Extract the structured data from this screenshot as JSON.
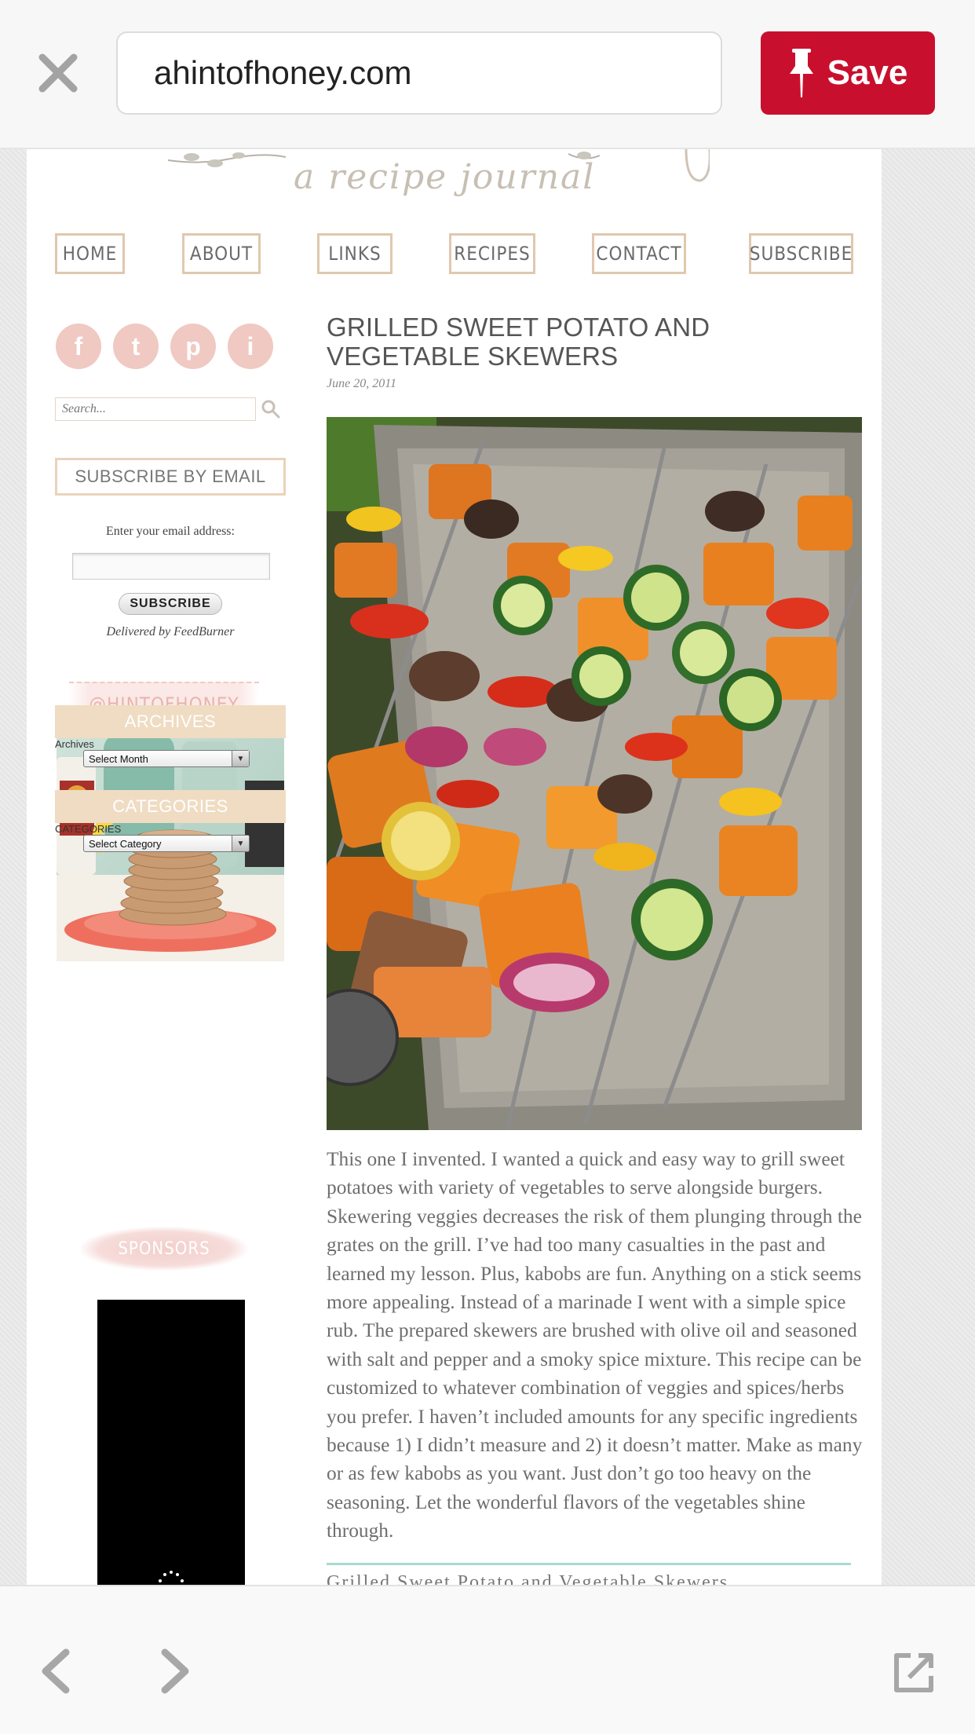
{
  "browser": {
    "url": "ahintofhoney.com",
    "save_label": "Save"
  },
  "site": {
    "tagline": "a recipe journal",
    "nav": [
      "HOME",
      "ABOUT",
      "LINKS",
      "RECIPES",
      "CONTACT",
      "SUBSCRIBE"
    ]
  },
  "sidebar": {
    "social": [
      "f",
      "t",
      "p",
      "i"
    ],
    "search_placeholder": "Search...",
    "subscribe_heading": "SUBSCRIBE BY EMAIL",
    "email_label": "Enter your email address:",
    "subscribe_button": "SUBSCRIBE",
    "delivered_prefix": "Delivered by ",
    "delivered_link": "FeedBurner",
    "handle": "@HINTOFHONEY",
    "archives_heading": "ARCHIVES",
    "archives_label": "Archives",
    "archives_select": "Select Month",
    "categories_heading": "CATEGORIES",
    "categories_label": "CATEGORIES",
    "categories_select": "Select Category",
    "sponsors_label": "SPONSORS"
  },
  "post": {
    "title": "GRILLED SWEET POTATO AND VEGETABLE SKEWERS",
    "date": "June 20, 2011",
    "body": "This one I invented. I wanted a quick and easy way to grill sweet potatoes with variety of vegetables to serve alongside burgers. Skewering veggies decreases the risk of them plunging through the grates on the grill. I’ve had too many casualties in the past and learned my lesson. Plus, kabobs are fun. Anything on a stick seems more appealing. Instead of a marinade I went with a simple spice rub. The prepared skewers are brushed with olive oil and seasoned with salt and pepper and a smoky spice mixture. This recipe can be customized to whatever combination of veggies and spices/herbs you prefer. I haven’t included amounts for any specific ingredients because 1) I didn’t measure and 2) it doesn’t matter. Make as many or as few kabobs as you want. Just don’t go too heavy on the seasoning. Let the wonderful flavors of the vegetables shine through.",
    "recipe_title_partial": "Grilled Sweet Potato and Vegetable Skewers"
  },
  "colors": {
    "save_red": "#c8102e",
    "nav_border": "#e0c8ae",
    "widget_tan": "#efdcc2",
    "social_pink": "#f0c9c2",
    "divider_teal": "#a7dad1"
  }
}
